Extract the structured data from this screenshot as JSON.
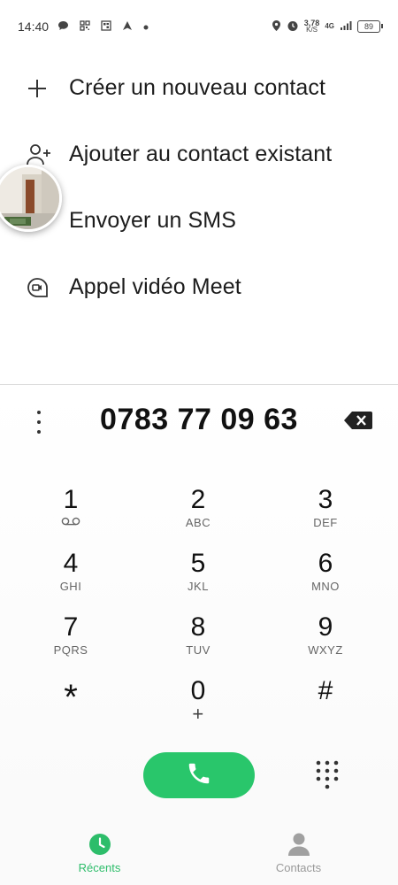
{
  "status_bar": {
    "time": "14:40",
    "speed_value": "3,78",
    "speed_unit": "K/S",
    "network": "4G",
    "battery": "89",
    "icons_left": [
      "chat-bubble-icon",
      "qr-icon",
      "qr-icon",
      "navigation-arrow-icon",
      "dot-icon"
    ],
    "icons_right": [
      "location-icon",
      "alarm-icon",
      "signal-icon",
      "battery-icon"
    ]
  },
  "options": [
    {
      "label": "Créer un nouveau contact",
      "icon": "plus-icon"
    },
    {
      "label": "Ajouter au contact existant",
      "icon": "person-add-icon"
    },
    {
      "label": "Envoyer un SMS",
      "icon": "message-icon"
    },
    {
      "label": "Appel vidéo Meet",
      "icon": "meet-video-icon"
    }
  ],
  "dialer": {
    "number": "0783 77 09 63"
  },
  "keypad": [
    {
      "digit": "1",
      "letters": "",
      "icon": "voicemail-icon"
    },
    {
      "digit": "2",
      "letters": "ABC"
    },
    {
      "digit": "3",
      "letters": "DEF"
    },
    {
      "digit": "4",
      "letters": "GHI"
    },
    {
      "digit": "5",
      "letters": "JKL"
    },
    {
      "digit": "6",
      "letters": "MNO"
    },
    {
      "digit": "7",
      "letters": "PQRS"
    },
    {
      "digit": "8",
      "letters": "TUV"
    },
    {
      "digit": "9",
      "letters": "WXYZ"
    },
    {
      "digit": "*",
      "letters": ""
    },
    {
      "digit": "0",
      "letters": "+"
    },
    {
      "digit": "#",
      "letters": ""
    }
  ],
  "bottom_nav": [
    {
      "label": "Récents",
      "active": true
    },
    {
      "label": "Contacts",
      "active": false
    }
  ],
  "colors": {
    "accent_green": "#29c66b",
    "nav_active": "#2dbd6a",
    "nav_inactive": "#999999"
  }
}
